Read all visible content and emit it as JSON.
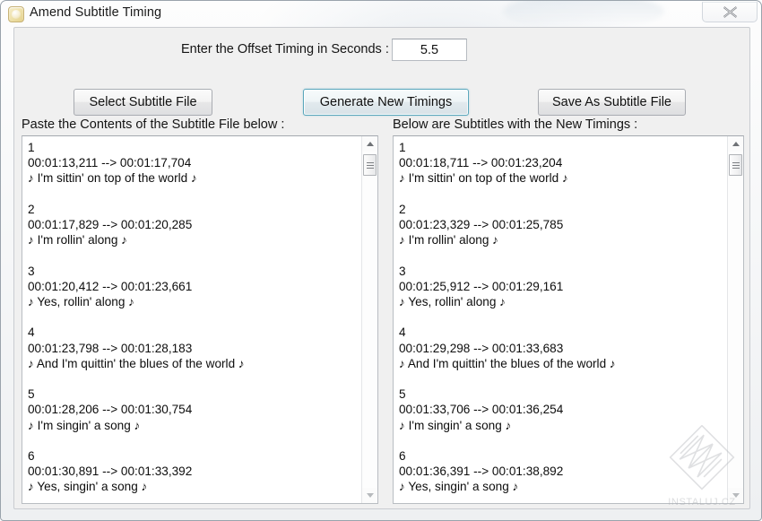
{
  "window": {
    "title": "Amend Subtitle Timing",
    "app_icon": "subtitle-app-icon",
    "close_label": "close-icon"
  },
  "offset": {
    "label": "Enter the Offset Timing in Seconds :",
    "value": "5.5",
    "placeholder": ""
  },
  "toolbar": {
    "select_file_label": "Select Subtitle File",
    "generate_label": "Generate New Timings",
    "save_file_label": "Save As Subtitle File"
  },
  "left_panel": {
    "caption": "Paste the Contents of the Subtitle File below :",
    "content": "1\n00:01:13,211 --> 00:01:17,704\n♪ I'm sittin' on top of the world ♪\n\n2\n00:01:17,829 --> 00:01:20,285\n♪ I'm rollin' along ♪\n\n3\n00:01:20,412 --> 00:01:23,661\n♪ Yes, rollin' along ♪\n\n4\n00:01:23,798 --> 00:01:28,183\n♪ And I'm quittin' the blues of the world ♪\n\n5\n00:01:28,206 --> 00:01:30,754\n♪ I'm singin' a song ♪\n\n6\n00:01:30,891 --> 00:01:33,392\n♪ Yes, singin' a song ♪"
  },
  "right_panel": {
    "caption": "Below are Subtitles with the New Timings :",
    "content": "1\n00:01:18,711 --> 00:01:23,204\n♪ I'm sittin' on top of the world ♪\n\n2\n00:01:23,329 --> 00:01:25,785\n♪ I'm rollin' along ♪\n\n3\n00:01:25,912 --> 00:01:29,161\n♪ Yes, rollin' along ♪\n\n4\n00:01:29,298 --> 00:01:33,683\n♪ And I'm quittin' the blues of the world ♪\n\n5\n00:01:33,706 --> 00:01:36,254\n♪ I'm singin' a song ♪\n\n6\n00:01:36,391 --> 00:01:38,892\n♪ Yes, singin' a song ♪"
  },
  "watermark": {
    "text": "INSTALUJ.CZ"
  },
  "colors": {
    "window_background": "#f0f0f0",
    "focus_border": "#5ba7bc",
    "text": "#0d0d0d",
    "button_face": "#f3f3f3"
  }
}
